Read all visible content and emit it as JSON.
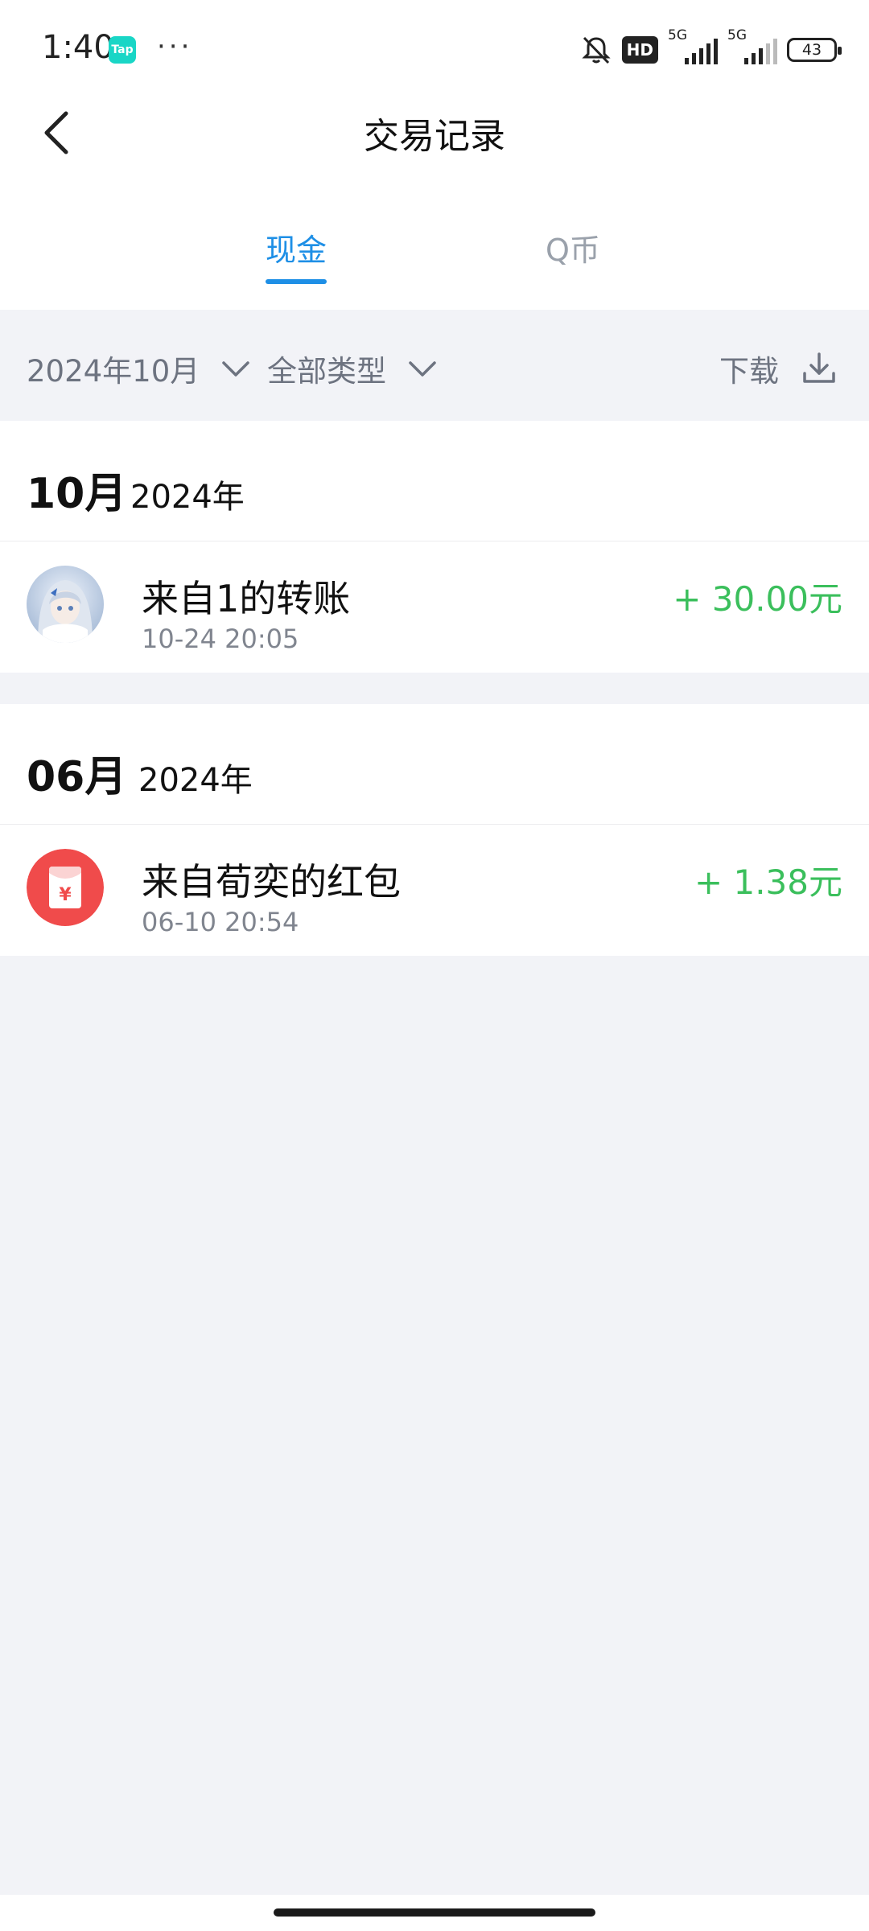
{
  "status_bar": {
    "time": "1:40",
    "tap_badge": "Tap",
    "more": "···",
    "hd": "HD",
    "sim1_label": "5G",
    "sim2_label": "5G",
    "battery": "43"
  },
  "header": {
    "title": "交易记录"
  },
  "tabs": [
    {
      "label": "现金",
      "active": true
    },
    {
      "label": "Q币",
      "active": false
    }
  ],
  "filters": {
    "date": "2024年10月",
    "type": "全部类型",
    "download": "下载"
  },
  "groups": [
    {
      "month": "10月",
      "year": "2024年",
      "transactions": [
        {
          "title": "来自1的转账",
          "time": "10-24 20:05",
          "amount": "+ 30.00元",
          "icon": "user-avatar"
        }
      ]
    },
    {
      "month": "06月",
      "year": "2024年",
      "transactions": [
        {
          "title": "来自荀奕的红包",
          "time": "06-10 20:54",
          "amount": "+ 1.38元",
          "icon": "red-packet-icon"
        }
      ]
    }
  ],
  "colors": {
    "accent": "#1e8fe6",
    "income": "#3bbf5c",
    "red_packet": "#f04b4b",
    "background": "#f2f3f7"
  }
}
